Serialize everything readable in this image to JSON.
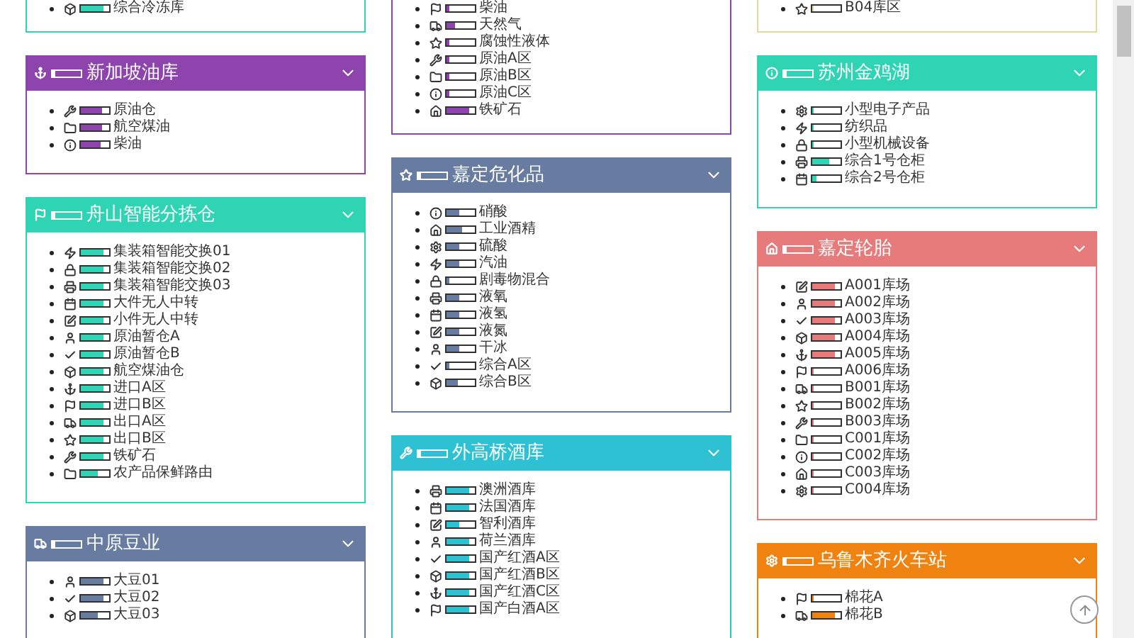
{
  "columns": [
    {
      "cards": [
        {
          "color": "#2fd4b4",
          "items": [
            {
              "label": "综合冷冻库",
              "level": 0.8
            }
          ]
        },
        {
          "title": "新加坡油库",
          "color": "#8e44ad",
          "level": 0.1,
          "items": [
            {
              "label": "原油仓",
              "level": 0.75
            },
            {
              "label": "航空煤油",
              "level": 0.75
            },
            {
              "label": "柴油",
              "level": 0.7
            }
          ]
        },
        {
          "title": "舟山智能分拣仓",
          "color": "#2fd4b4",
          "level": 0.1,
          "items": [
            {
              "label": "集装箱智能交换01",
              "level": 0.8
            },
            {
              "label": "集装箱智能交换02",
              "level": 0.8
            },
            {
              "label": "集装箱智能交换03",
              "level": 0.8
            },
            {
              "label": "大件无人中转",
              "level": 0.8
            },
            {
              "label": "小件无人中转",
              "level": 0.8
            },
            {
              "label": "原油暂仓A",
              "level": 0.8
            },
            {
              "label": "原油暂仓B",
              "level": 0.8
            },
            {
              "label": "航空煤油仓",
              "level": 0.8
            },
            {
              "label": "进口A区",
              "level": 0.8
            },
            {
              "label": "进口B区",
              "level": 0.8
            },
            {
              "label": "出口A区",
              "level": 0.8
            },
            {
              "label": "出口B区",
              "level": 0.8
            },
            {
              "label": "铁矿石",
              "level": 0.8
            },
            {
              "label": "农产品保鲜路由",
              "level": 0.6
            }
          ]
        },
        {
          "title": "中原豆业",
          "color": "#677ca0",
          "level": 0.1,
          "items": [
            {
              "label": "大豆01",
              "level": 0.8
            },
            {
              "label": "大豆02",
              "level": 0.8
            },
            {
              "label": "大豆03",
              "level": 0.6
            }
          ]
        }
      ]
    },
    {
      "cards": [
        {
          "color": "#8e44ad",
          "items": [
            {
              "label": "柴油",
              "level": 0.1
            },
            {
              "label": "天然气",
              "level": 0.3
            },
            {
              "label": "腐蚀性液体",
              "level": 0.1
            },
            {
              "label": "原油A区",
              "level": 0.1
            },
            {
              "label": "原油B区",
              "level": 0.1
            },
            {
              "label": "原油C区",
              "level": 0.1
            },
            {
              "label": "铁矿石",
              "level": 0.8
            }
          ]
        },
        {
          "title": "嘉定危化品",
          "color": "#677ca0",
          "level": 0.1,
          "items": [
            {
              "label": "硝酸",
              "level": 0.45
            },
            {
              "label": "工业酒精",
              "level": 0.55
            },
            {
              "label": "硫酸",
              "level": 0.45
            },
            {
              "label": "汽油",
              "level": 0.45
            },
            {
              "label": "剧毒物混合",
              "level": 0.1
            },
            {
              "label": "液氧",
              "level": 0.45
            },
            {
              "label": "液氢",
              "level": 0.45
            },
            {
              "label": "液氮",
              "level": 0.45
            },
            {
              "label": "干冰",
              "level": 0.45
            },
            {
              "label": "综合A区",
              "level": 0.1
            },
            {
              "label": "综合B区",
              "level": 0.4
            }
          ]
        },
        {
          "title": "外高桥酒库",
          "color": "#2ec1d4",
          "level": 0.1,
          "items": [
            {
              "label": "澳洲酒库",
              "level": 0.8
            },
            {
              "label": "法国酒库",
              "level": 0.8
            },
            {
              "label": "智利酒库",
              "level": 0.45
            },
            {
              "label": "荷兰酒库",
              "level": 0.8
            },
            {
              "label": "国产红酒A区",
              "level": 0.8
            },
            {
              "label": "国产红酒B区",
              "level": 0.8
            },
            {
              "label": "国产红酒C区",
              "level": 0.8
            },
            {
              "label": "国产白酒A区",
              "level": 0.8
            }
          ]
        }
      ]
    },
    {
      "cards": [
        {
          "color": "#e3d9a0",
          "items": [
            {
              "label": "B04库区",
              "level": 0.05
            }
          ]
        },
        {
          "title": "苏州金鸡湖",
          "color": "#2fd4b4",
          "level": 0.1,
          "items": [
            {
              "label": "小型电子产品",
              "level": 0.05
            },
            {
              "label": "纺织品",
              "level": 0.05
            },
            {
              "label": "小型机械设备",
              "level": 0.05
            },
            {
              "label": "综合1号仓柜",
              "level": 0.6
            },
            {
              "label": "综合2号仓柜",
              "level": 0.15
            }
          ]
        },
        {
          "title": "嘉定轮胎",
          "color": "#e77b7b",
          "level": 0.1,
          "items": [
            {
              "label": "A001库场",
              "level": 0.8
            },
            {
              "label": "A002库场",
              "level": 0.8
            },
            {
              "label": "A003库场",
              "level": 0.8
            },
            {
              "label": "A004库场",
              "level": 0.8
            },
            {
              "label": "A005库场",
              "level": 0.8
            },
            {
              "label": "A006库场",
              "level": 0.05
            },
            {
              "label": "B001库场",
              "level": 0.05
            },
            {
              "label": "B002库场",
              "level": 0.05
            },
            {
              "label": "B003库场",
              "level": 0.05
            },
            {
              "label": "C001库场",
              "level": 0.05
            },
            {
              "label": "C002库场",
              "level": 0.05
            },
            {
              "label": "C003库场",
              "level": 0.05
            },
            {
              "label": "C004库场",
              "level": 0.05
            }
          ]
        },
        {
          "title": "乌鲁木齐火车站",
          "color": "#f0820f",
          "level": 0.1,
          "items": [
            {
              "label": "棉花A",
              "level": 0.05
            },
            {
              "label": "棉花B",
              "level": 0.8
            }
          ]
        }
      ]
    }
  ]
}
